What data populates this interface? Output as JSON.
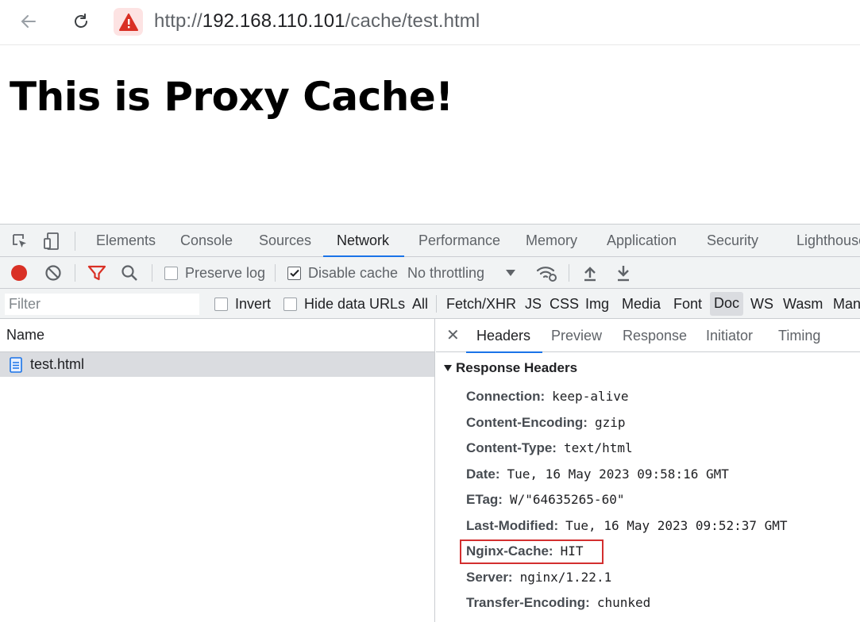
{
  "browser": {
    "url_scheme": "http://",
    "url_host": "192.168.110.101",
    "url_path": "/cache/test.html"
  },
  "page": {
    "heading": "This is Proxy Cache!"
  },
  "devtools": {
    "tabs": [
      "Elements",
      "Console",
      "Sources",
      "Network",
      "Performance",
      "Memory",
      "Application",
      "Security",
      "Lighthouse"
    ],
    "active_tab": "Network",
    "toolbar": {
      "preserve_log": "Preserve log",
      "disable_cache": "Disable cache",
      "throttling": "No throttling"
    },
    "filter": {
      "placeholder": "Filter",
      "invert": "Invert",
      "hide_data_urls": "Hide data URLs",
      "types": [
        "All",
        "Fetch/XHR",
        "JS",
        "CSS",
        "Img",
        "Media",
        "Font",
        "Doc",
        "WS",
        "Wasm",
        "Manifest"
      ],
      "active_type": "Doc"
    },
    "requests": {
      "column_name": "Name",
      "items": [
        {
          "name": "test.html"
        }
      ]
    },
    "details": {
      "tabs": [
        "Headers",
        "Preview",
        "Response",
        "Initiator",
        "Timing"
      ],
      "active_tab": "Headers",
      "section_title": "Response Headers",
      "headers": [
        {
          "key": "Connection:",
          "value": "keep-alive"
        },
        {
          "key": "Content-Encoding:",
          "value": "gzip"
        },
        {
          "key": "Content-Type:",
          "value": "text/html"
        },
        {
          "key": "Date:",
          "value": "Tue, 16 May 2023 09:58:16 GMT"
        },
        {
          "key": "ETag:",
          "value": "W/\"64635265-60\""
        },
        {
          "key": "Last-Modified:",
          "value": "Tue, 16 May 2023 09:52:37 GMT"
        },
        {
          "key": "Nginx-Cache:",
          "value": "HIT"
        },
        {
          "key": "Server:",
          "value": "nginx/1.22.1"
        },
        {
          "key": "Transfer-Encoding:",
          "value": "chunked"
        }
      ],
      "highlighted_header": "Nginx-Cache:"
    }
  },
  "colors": {
    "accent": "#1a73e8",
    "record": "#d93025",
    "highlight": "#d32f2f"
  }
}
